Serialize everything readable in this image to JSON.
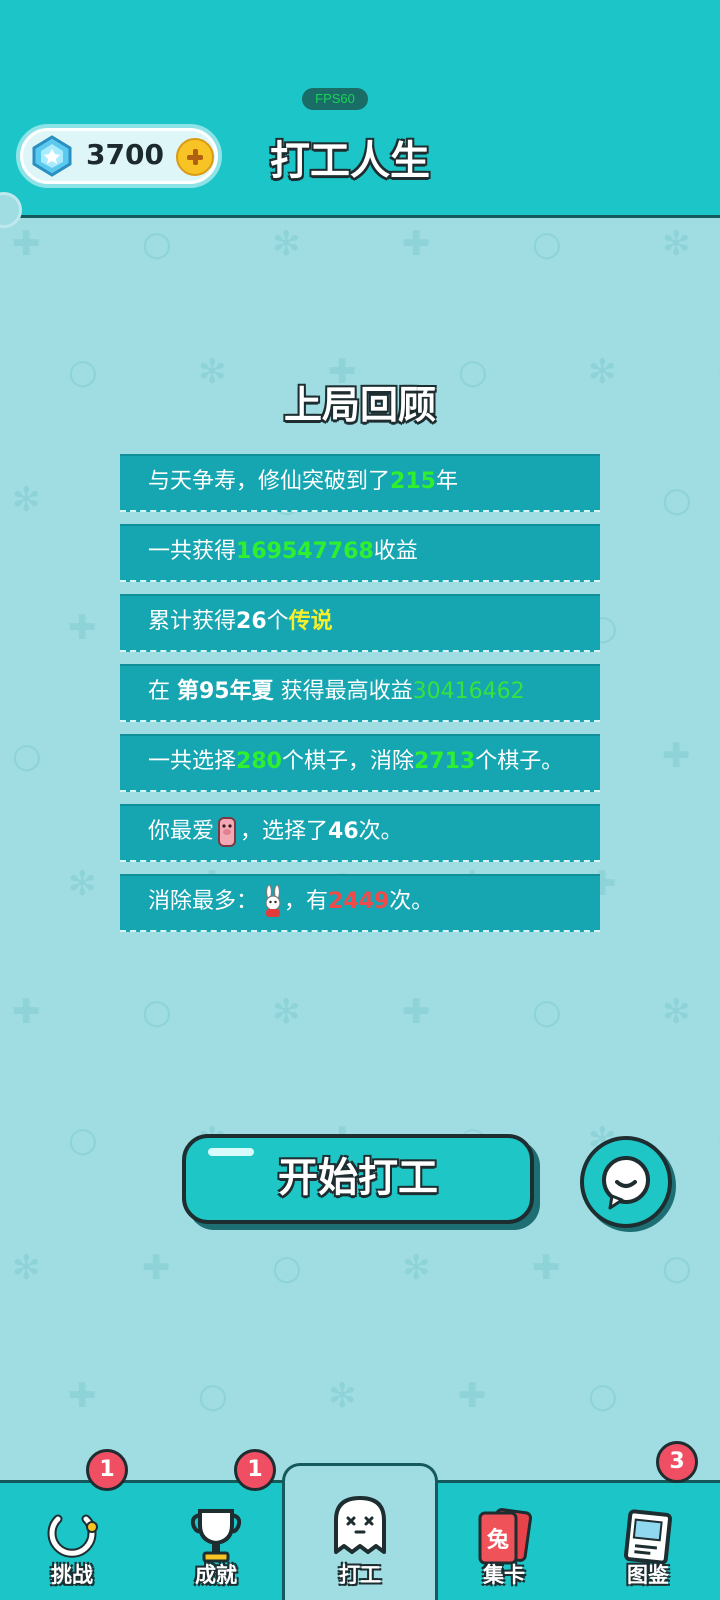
{
  "header": {
    "fps": "FPS60",
    "gems": "3700",
    "title": "打工人生"
  },
  "review": {
    "title": "上局回顾",
    "rows": [
      {
        "parts": [
          {
            "t": "与天争寿，修仙突破到了",
            "c": ""
          },
          {
            "t": "215",
            "c": "g"
          },
          {
            "t": "年",
            "c": ""
          }
        ]
      },
      {
        "parts": [
          {
            "t": "一共获得",
            "c": ""
          },
          {
            "t": "169547768",
            "c": "g"
          },
          {
            "t": "收益",
            "c": ""
          }
        ]
      },
      {
        "parts": [
          {
            "t": "累计获得",
            "c": ""
          },
          {
            "t": "26",
            "c": "b"
          },
          {
            "t": "个",
            "c": ""
          },
          {
            "t": "传说",
            "c": "y"
          }
        ]
      },
      {
        "parts": [
          {
            "t": "在 ",
            "c": ""
          },
          {
            "t": "第95年夏",
            "c": "b"
          },
          {
            "t": " 获得最高收益",
            "c": ""
          },
          {
            "t": "30416462",
            "c": "gl"
          }
        ]
      },
      {
        "parts": [
          {
            "t": "一共选择",
            "c": ""
          },
          {
            "t": "280",
            "c": "g"
          },
          {
            "t": "个棋子，消除",
            "c": ""
          },
          {
            "t": "2713",
            "c": "g"
          },
          {
            "t": "个棋子。",
            "c": ""
          }
        ]
      },
      {
        "parts": [
          {
            "t": "你最爱",
            "c": ""
          },
          {
            "t": "pig",
            "c": "icon"
          },
          {
            "t": "，选择了",
            "c": ""
          },
          {
            "t": "46",
            "c": "b"
          },
          {
            "t": "次。",
            "c": ""
          }
        ]
      },
      {
        "parts": [
          {
            "t": "消除最多：",
            "c": ""
          },
          {
            "t": "rabbit",
            "c": "icon"
          },
          {
            "t": "，有",
            "c": ""
          },
          {
            "t": "2449",
            "c": "r"
          },
          {
            "t": "次。",
            "c": ""
          }
        ]
      }
    ]
  },
  "start_button": "开始打工",
  "nav": [
    {
      "label": "挑战",
      "badge": "1",
      "icon": "challenge-ring-icon"
    },
    {
      "label": "成就",
      "badge": "1",
      "icon": "trophy-icon"
    },
    {
      "label": "打工",
      "badge": "",
      "icon": "ghost-icon"
    },
    {
      "label": "集卡",
      "badge": "",
      "icon": "card-stack-icon",
      "card_char": "兔"
    },
    {
      "label": "图鉴",
      "badge": "3",
      "icon": "book-icon"
    }
  ],
  "colors": {
    "header_bg": "#1cc6c8",
    "body_bg": "#9fdde2",
    "row_bg": "#16a6b2",
    "highlight_green": "#2ff02f",
    "highlight_yellow": "#f5f02a",
    "highlight_red": "#f04a4a"
  }
}
